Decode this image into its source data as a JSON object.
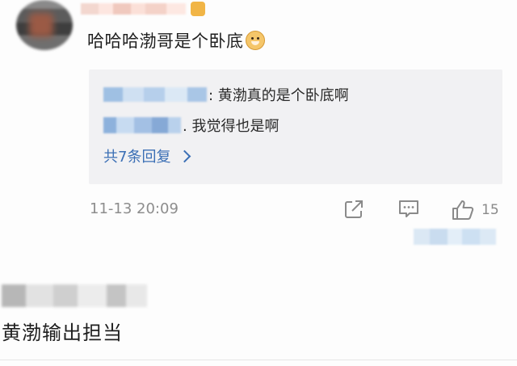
{
  "comment1": {
    "text": "哈哈哈渤哥是个卧底",
    "emoji": "dog-emoji",
    "replies": [
      {
        "text": ": 黄渤真的是个卧底啊"
      },
      {
        "text": ". 我觉得也是啊"
      }
    ],
    "more_replies": "共7条回复",
    "timestamp": "11-13 20:09",
    "like_count": "15"
  },
  "comment2": {
    "text": "黄渤输出担当"
  }
}
